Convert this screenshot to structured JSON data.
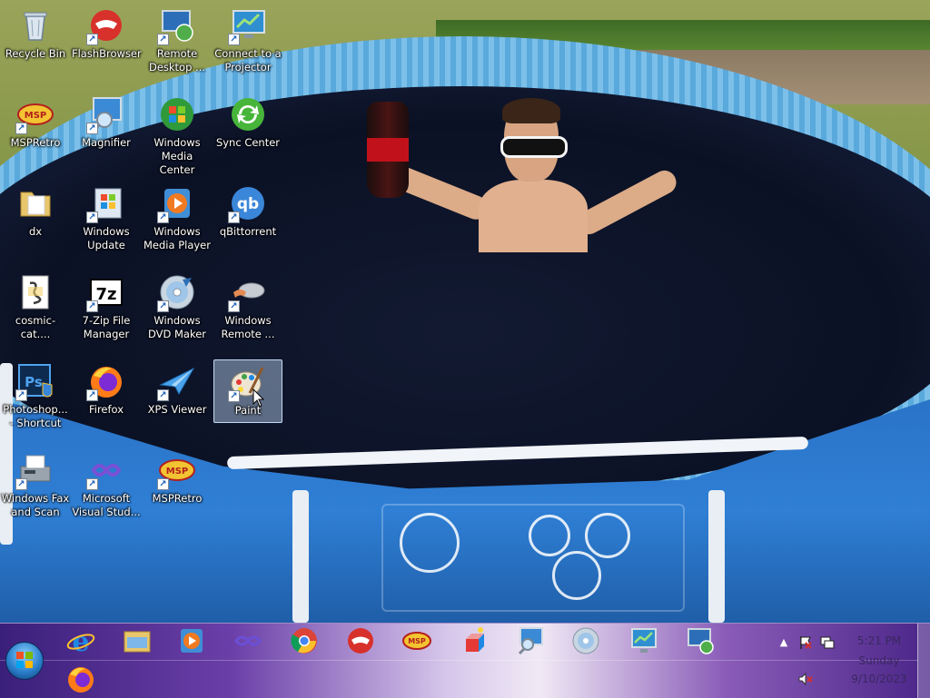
{
  "desktop": {
    "icons": [
      {
        "label": "Recycle Bin",
        "icon": "recycle-bin-icon"
      },
      {
        "label": "FlashBrowser",
        "icon": "flashbrowser-icon"
      },
      {
        "label": "Remote\nDesktop ...",
        "icon": "remote-desktop-icon"
      },
      {
        "label": "Connect to a\nProjector",
        "icon": "projector-icon"
      },
      {
        "label": "MSPRetro",
        "icon": "mspretro-icon"
      },
      {
        "label": "Magnifier",
        "icon": "magnifier-icon"
      },
      {
        "label": "Windows\nMedia Center",
        "icon": "media-center-icon"
      },
      {
        "label": "Sync Center",
        "icon": "sync-center-icon"
      },
      {
        "label": "dx",
        "icon": "folder-icon"
      },
      {
        "label": "Windows\nUpdate",
        "icon": "windows-update-icon"
      },
      {
        "label": "Windows\nMedia Player",
        "icon": "media-player-icon"
      },
      {
        "label": "qBittorrent",
        "icon": "qbittorrent-icon"
      },
      {
        "label": "cosmic-cat....",
        "icon": "script-file-icon"
      },
      {
        "label": "7-Zip File\nManager",
        "icon": "7zip-icon"
      },
      {
        "label": "Windows\nDVD Maker",
        "icon": "dvd-maker-icon"
      },
      {
        "label": "Windows\nRemote ...",
        "icon": "remote-assistance-icon"
      },
      {
        "label": "Photoshop...\n- Shortcut",
        "icon": "photoshop-icon"
      },
      {
        "label": "Firefox",
        "icon": "firefox-icon"
      },
      {
        "label": "XPS Viewer",
        "icon": "xps-viewer-icon"
      },
      {
        "label": "Paint",
        "icon": "paint-icon",
        "selected": true
      },
      {
        "label": "Windows Fax\nand Scan",
        "icon": "fax-scan-icon"
      },
      {
        "label": "Microsoft\nVisual Stud...",
        "icon": "visual-studio-icon"
      },
      {
        "label": "MSPRetro",
        "icon": "mspretro-icon"
      }
    ]
  },
  "taskbar": {
    "start_button": "windows-start-orb",
    "pinned_row1": [
      "internet-explorer-icon",
      "file-explorer-icon",
      "media-player-icon",
      "visual-studio-icon",
      "chrome-icon",
      "flashbrowser-icon",
      "mspretro-icon",
      "paint-3d-icon",
      "magnifier-icon",
      "dvd-maker-icon",
      "projector-icon",
      "remote-desktop-icon"
    ],
    "pinned_row2": [
      "firefox-icon"
    ],
    "tray": {
      "icons": [
        "show-hidden-icons-arrow",
        "action-center-flag-icon",
        "network-icon",
        "volume-muted-icon"
      ],
      "time": "5:21 PM",
      "day": "Sunday",
      "date": "9/10/2023"
    }
  },
  "colors": {
    "label_text": "#ffffff",
    "selection": "#bed7f5",
    "taskbar_dark": "#3a1f7a",
    "clock_text": "#3a2860"
  }
}
